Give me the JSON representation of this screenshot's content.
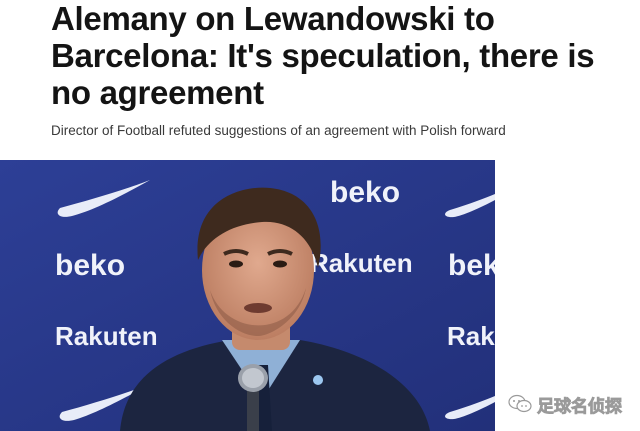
{
  "article": {
    "headline": "Alemany on Lewandowski to Barcelona: It's speculation, there is no agreement",
    "subtitle": "Director of Football refuted suggestions of an agreement with Polish forward"
  },
  "photo": {
    "backdrop_color": "#2b3b8f",
    "sponsor_beko": "beko",
    "sponsor_rakuten": "Rakuten",
    "sponsor_beko_partial": "bek",
    "sponsor_rakuten_partial": "Rak"
  },
  "watermark": {
    "text": "足球名侦探",
    "icon": "wechat-icon"
  }
}
